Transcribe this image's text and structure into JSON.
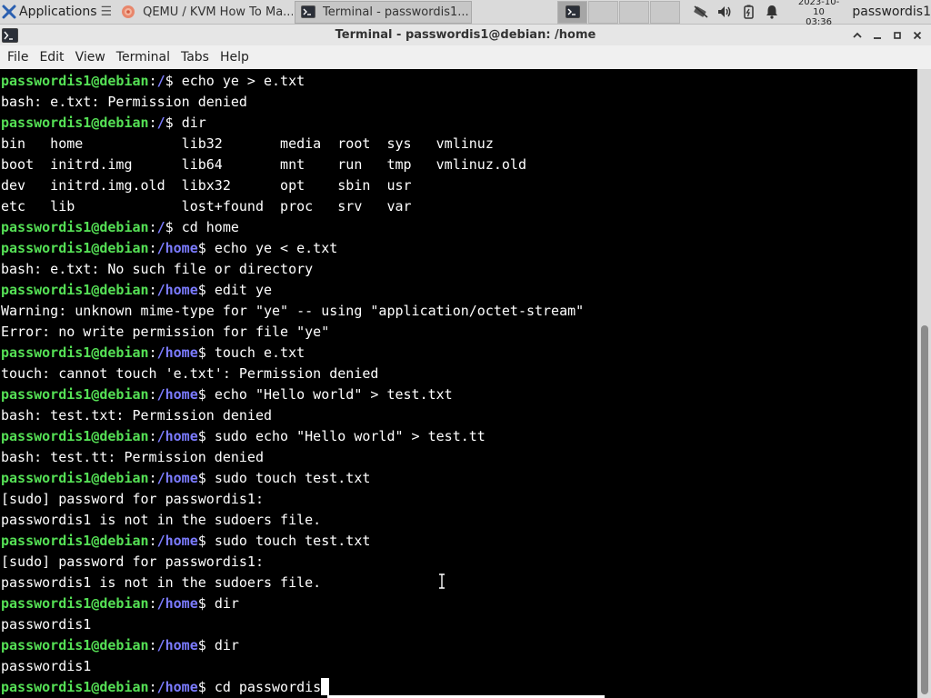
{
  "panel": {
    "applications_label": "Applications",
    "tasks": [
      {
        "label": "QEMU / KVM How To Ma...",
        "active": false
      },
      {
        "label": "Terminal - passwordis1...",
        "active": true
      }
    ],
    "clock": {
      "date": "2023-10-10",
      "time": "03:36"
    },
    "user": "passwordis1"
  },
  "window": {
    "title": "Terminal - passwordis1@debian: /home"
  },
  "menu": [
    "File",
    "Edit",
    "View",
    "Terminal",
    "Tabs",
    "Help"
  ],
  "terminal": {
    "prompt_user": "passwordis1@debian",
    "lines": [
      {
        "type": "prompt",
        "path": "/",
        "cmd": "echo ye > e.txt"
      },
      {
        "type": "out",
        "text": "bash: e.txt: Permission denied"
      },
      {
        "type": "prompt",
        "path": "/",
        "cmd": "dir"
      },
      {
        "type": "out",
        "text": "bin   home            lib32       media  root  sys   vmlinuz"
      },
      {
        "type": "out",
        "text": "boot  initrd.img      lib64       mnt    run   tmp   vmlinuz.old"
      },
      {
        "type": "out",
        "text": "dev   initrd.img.old  libx32      opt    sbin  usr"
      },
      {
        "type": "out",
        "text": "etc   lib             lost+found  proc   srv   var"
      },
      {
        "type": "prompt",
        "path": "/",
        "cmd": "cd home"
      },
      {
        "type": "prompt",
        "path": "/home",
        "cmd": "echo ye < e.txt"
      },
      {
        "type": "out",
        "text": "bash: e.txt: No such file or directory"
      },
      {
        "type": "prompt",
        "path": "/home",
        "cmd": "edit ye"
      },
      {
        "type": "out",
        "text": "Warning: unknown mime-type for \"ye\" -- using \"application/octet-stream\""
      },
      {
        "type": "out",
        "text": "Error: no write permission for file \"ye\""
      },
      {
        "type": "prompt",
        "path": "/home",
        "cmd": "touch e.txt"
      },
      {
        "type": "out",
        "text": "touch: cannot touch 'e.txt': Permission denied"
      },
      {
        "type": "prompt",
        "path": "/home",
        "cmd": "echo \"Hello world\" > test.txt"
      },
      {
        "type": "out",
        "text": "bash: test.txt: Permission denied"
      },
      {
        "type": "prompt",
        "path": "/home",
        "cmd": "sudo echo \"Hello world\" > test.tt"
      },
      {
        "type": "out",
        "text": "bash: test.tt: Permission denied"
      },
      {
        "type": "prompt",
        "path": "/home",
        "cmd": "sudo touch test.txt"
      },
      {
        "type": "out",
        "text": "[sudo] password for passwordis1:"
      },
      {
        "type": "out",
        "text": "passwordis1 is not in the sudoers file."
      },
      {
        "type": "prompt",
        "path": "/home",
        "cmd": "sudo touch test.txt"
      },
      {
        "type": "out",
        "text": "[sudo] password for passwordis1:"
      },
      {
        "type": "out",
        "text": "passwordis1 is not in the sudoers file."
      },
      {
        "type": "prompt",
        "path": "/home",
        "cmd": "dir"
      },
      {
        "type": "out",
        "text": "passwordis1"
      },
      {
        "type": "prompt",
        "path": "/home",
        "cmd": "dir"
      },
      {
        "type": "out",
        "text": "passwordis1"
      },
      {
        "type": "prompt",
        "path": "/home",
        "cmd": "cd passwordis",
        "cursor": true
      }
    ]
  },
  "colors": {
    "prompt_user": "#55e055",
    "prompt_path": "#7b7bff",
    "terminal_bg": "#000000",
    "terminal_fg": "#ffffff"
  },
  "icons": {
    "applications": "xfce-mouse-icon",
    "task_browser": "browser-icon",
    "task_terminal": "terminal-icon",
    "tray": [
      "network-icon",
      "volume-icon",
      "battery-icon",
      "notification-bell-icon"
    ],
    "window": "terminal-icon",
    "window_buttons": [
      "chevron-up-icon",
      "minimize-icon",
      "maximize-icon",
      "close-icon"
    ]
  }
}
